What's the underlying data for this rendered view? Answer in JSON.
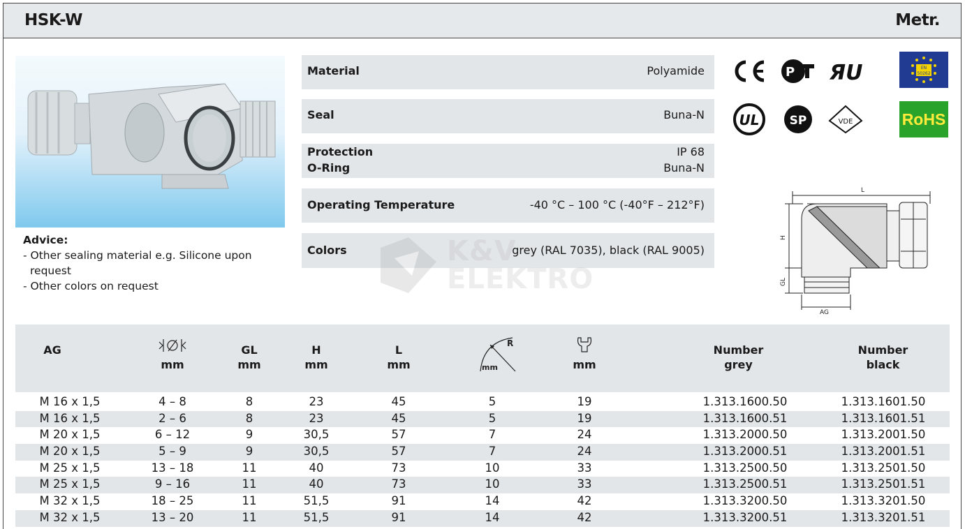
{
  "header": {
    "title": "HSK-W",
    "thread_type": "Metr."
  },
  "advice": {
    "heading": "Advice:",
    "lines": [
      "- Other sealing material e.g. Silicone upon request",
      "- Other colors on request"
    ]
  },
  "properties": [
    {
      "name": "Material",
      "value": "Polyamide"
    },
    {
      "name": "Seal",
      "value": "Buna-N"
    },
    {
      "name": "Protection",
      "value": "IP 68",
      "name2": "O-Ring",
      "value2": "Buna-N"
    },
    {
      "name": "Operating Temperature",
      "value": "-40 °C – 100 °C (-40°F – 212°F)"
    },
    {
      "name": "Colors",
      "value": "grey (RAL 7035), black (RAL 9005)"
    }
  ],
  "certifications": {
    "ce": "CE",
    "rohs": "RoHS",
    "en_badge": "EN 50262",
    "vde": "VDE"
  },
  "drawing_labels": {
    "l": "L",
    "h": "H",
    "gl": "GL",
    "ag": "AG"
  },
  "watermark": {
    "line1": "K&V",
    "line2": "ELEKTRO"
  },
  "table": {
    "headers": {
      "ag": "AG",
      "clamp_unit": "mm",
      "gl": "GL",
      "gl_unit": "mm",
      "h": "H",
      "h_unit": "mm",
      "l": "L",
      "l_unit": "mm",
      "r_label": "R",
      "r_unit": "mm",
      "wrench_unit": "mm",
      "number_grey_1": "Number",
      "number_grey_2": "grey",
      "number_black_1": "Number",
      "number_black_2": "black"
    },
    "rows": [
      [
        "M 16 x 1,5",
        "4 – 8",
        "8",
        "23",
        "45",
        "5",
        "19",
        "1.313.1600.50",
        "1.313.1601.50"
      ],
      [
        "M 16 x 1,5",
        "2 – 6",
        "8",
        "23",
        "45",
        "5",
        "19",
        "1.313.1600.51",
        "1.313.1601.51"
      ],
      [
        "M 20 x 1,5",
        "6 – 12",
        "9",
        "30,5",
        "57",
        "7",
        "24",
        "1.313.2000.50",
        "1.313.2001.50"
      ],
      [
        "M 20 x 1,5",
        "5 – 9",
        "9",
        "30,5",
        "57",
        "7",
        "24",
        "1.313.2000.51",
        "1.313.2001.51"
      ],
      [
        "M 25 x 1,5",
        "13 – 18",
        "11",
        "40",
        "73",
        "10",
        "33",
        "1.313.2500.50",
        "1.313.2501.50"
      ],
      [
        "M 25 x 1,5",
        "9 – 16",
        "11",
        "40",
        "73",
        "10",
        "33",
        "1.313.2500.51",
        "1.313.2501.51"
      ],
      [
        "M 32 x 1,5",
        "18 – 25",
        "11",
        "51,5",
        "91",
        "14",
        "42",
        "1.313.3200.50",
        "1.313.3201.50"
      ],
      [
        "M 32 x 1,5",
        "13 – 20",
        "11",
        "51,5",
        "91",
        "14",
        "42",
        "1.313.3200.51",
        "1.313.3201.51"
      ]
    ]
  }
}
